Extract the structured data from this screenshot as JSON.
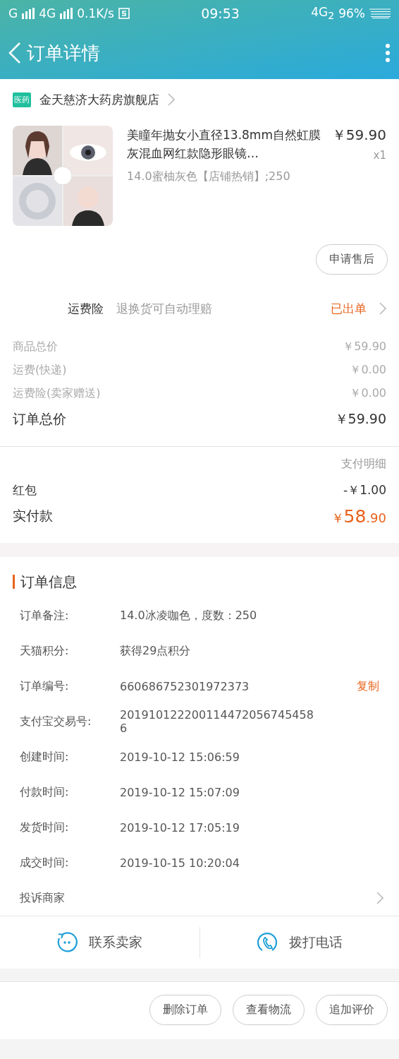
{
  "status_bar": {
    "carrier_1": "G",
    "carrier_2": "4G",
    "speed": "0.1K/s",
    "time": "09:53",
    "network": "4G$_{2}$",
    "battery": "96%"
  },
  "header": {
    "title": "订单详情"
  },
  "store": {
    "badge": "医药",
    "name": "金天慈济大药房旗舰店"
  },
  "product": {
    "kind": "picture",
    "title": "美瞳年抛女小直径13.8mm自然虹膜灰混血网红款隐形眼镜…",
    "price": "￥59.90",
    "quantity": "x1",
    "spec": "14.0蜜柚灰色【店铺热销】;250",
    "after_sale": "申请售后"
  },
  "insurance": {
    "label": "运费险",
    "desc": "退换货可自动理赔",
    "status": "已出单"
  },
  "costs": [
    {
      "label": "商品总价",
      "value": "￥59.90"
    },
    {
      "label": "运费(快递)",
      "value": "￥0.00"
    },
    {
      "label": "运费险(卖家赠送)",
      "value": "￥0.00"
    }
  ],
  "total": {
    "label": "订单总价",
    "value": "￥59.90"
  },
  "payment": {
    "detail_label": "支付明细",
    "red_packet_label": "红包",
    "red_packet_value": "-￥1.00",
    "paid_label": "实付款",
    "paid_currency": "￥",
    "paid_integer": "58",
    "paid_decimal": ".90"
  },
  "order_info": {
    "title": "订单信息",
    "rows": [
      {
        "label": "订单备注:",
        "value": "14.0冰凌咖色，度数：250"
      },
      {
        "label": "天猫积分:",
        "value": "获得29点积分"
      },
      {
        "label": "订单编号:",
        "value": "660686752301972373",
        "action": "复制"
      },
      {
        "label": "支付宝交易号:",
        "value": "2019101222001144720567454586"
      },
      {
        "label": "创建时间:",
        "value": "2019-10-12 15:06:59"
      },
      {
        "label": "付款时间:",
        "value": "2019-10-12 15:07:09"
      },
      {
        "label": "发货时间:",
        "value": "2019-10-12 17:05:19"
      },
      {
        "label": "成交时间:",
        "value": "2019-10-15 10:20:04"
      }
    ],
    "complaint": "投诉商家"
  },
  "contact": [
    {
      "kind": "chat",
      "label": "联系卖家"
    },
    {
      "kind": "phone",
      "label": "拨打电话"
    }
  ],
  "actions": [
    "删除订单",
    "查看物流",
    "追加评价"
  ]
}
